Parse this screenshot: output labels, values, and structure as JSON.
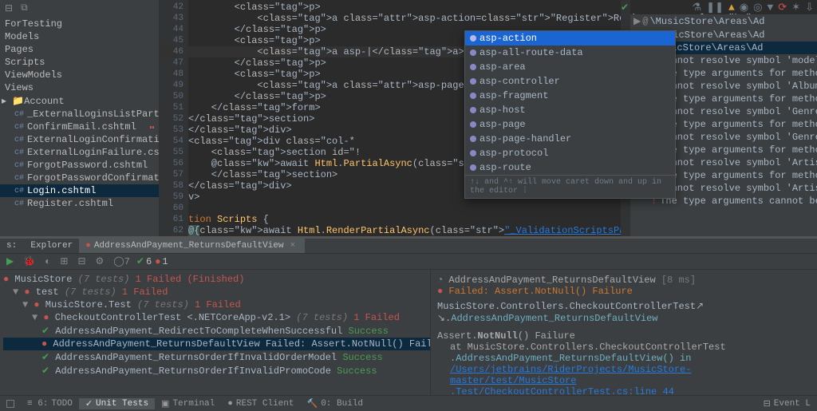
{
  "project_tree": {
    "folders": [
      "ForTesting",
      "Models",
      "Pages",
      "Scripts",
      "ViewModels",
      "Views"
    ],
    "active_folder": "Account",
    "files": [
      "_ExternalLoginsListPartial.c",
      "ConfirmEmail.cshtml",
      "ExternalLoginConfirmation.c",
      "ExternalLoginFailure.cshtm",
      "ForgotPassword.cshtml",
      "ForgotPasswordConfirmatic",
      "Login.cshtml",
      "Register.cshtml"
    ],
    "selected": "Login.cshtml"
  },
  "editor": {
    "line_start": 42,
    "lines": [
      "        <p>",
      "            <a asp-action=\"Register\">Register as a new user?</a>",
      "        </p>",
      "        <p>",
      "            <a asp-|</a>",
      "        </p>",
      "        <p>",
      "            <a asp-page=\"./ForgotPassword\">Forgot your password?</a>",
      "        </p>",
      "    </form>",
      "</section>",
      "</div>",
      "<div class=\"col-*",
      "    <section id=\"!",
      "    @await Html.PartialAsync(\"_ExternalLoginsListPartial\", new ExternalLogin!",
      "    </section>",
      "</div>",
      "v>",
      "",
      "tion Scripts {",
      "@{await Html.RenderPartialAsync(\"_ValidationScriptsPartial\"); }",
      ""
    ]
  },
  "completion": {
    "prefix": "asp-",
    "items": [
      "asp-action",
      "asp-all-route-data",
      "asp-area",
      "asp-controller",
      "asp-fragment",
      "asp-host",
      "asp-page",
      "asp-page-handler",
      "asp-protocol",
      "asp-route"
    ],
    "selected": 0,
    "hint": "↑↓ and ^↑ will move caret down and up in the editor  ⁞"
  },
  "errors": {
    "groups": [
      "<samples>\\MusicStore\\Areas\\Ad",
      "<samples>\\MusicStore\\Areas\\Ad",
      "<samples>\\MusicStore\\Areas\\Ad"
    ],
    "items": [
      "Cannot resolve symbol 'model'",
      "The type arguments for method",
      "Cannot resolve symbol 'AlbumId",
      "The type arguments for method",
      "Cannot resolve symbol 'GenreId",
      "The type arguments for method",
      "Cannot resolve symbol 'GenreId",
      "The type arguments for method",
      "Cannot resolve symbol 'ArtistId",
      "The type arguments for method",
      "Cannot resolve symbol 'ArtistId",
      "The type arguments cannot be i"
    ]
  },
  "tests_tabs": {
    "left": "Explorer",
    "right": "AddressAndPayment_ReturnsDefaultView"
  },
  "tests_counts": {
    "pass": 6,
    "fail": 1
  },
  "tests_tree": {
    "root": {
      "name": "MusicStore",
      "count": "(7 tests)",
      "status": "1 Failed (Finished)"
    },
    "level1": {
      "name": "test",
      "count": "(7 tests)",
      "status": "1 Failed"
    },
    "level2": {
      "name": "MusicStore.Test",
      "count": "(7 tests)",
      "status": "1 Failed"
    },
    "level3": {
      "name": "CheckoutControllerTest <.NETCoreApp-v2.1>",
      "count": "(7 tests)",
      "status": "1 Failed"
    },
    "leaves": [
      {
        "name": "AddressAndPayment_RedirectToCompleteWhenSuccessful",
        "status": "Success",
        "ok": true
      },
      {
        "name": "AddressAndPayment_ReturnsDefaultView  Failed: Assert.NotNull() Failure",
        "status": "",
        "ok": false,
        "sel": true
      },
      {
        "name": "AddressAndPayment_ReturnsOrderIfInvalidOrderModel",
        "status": "Success",
        "ok": true
      },
      {
        "name": "AddressAndPayment_ReturnsOrderIfInvalidPromoCode",
        "status": "Success",
        "ok": true
      }
    ]
  },
  "tests_out": {
    "title": "AddressAndPayment_ReturnsDefaultView",
    "time": "[8 ms]",
    "fail_line": "Failed: Assert.NotNull() Failure",
    "cls": "MusicStore.Controllers.CheckoutControllerTest",
    "mtd": "AddressAndPayment_ReturnsDefaultView",
    "assert": "Assert.NotNull()",
    "failure_word": "Failure",
    "at": "at MusicStore.Controllers.CheckoutControllerTest",
    "in_mtd": ".AddressAndPayment_ReturnsDefaultView() in",
    "path1": "/Users/jetbrains/RiderProjects/MusicStore-master/test/MusicStore",
    "path2": ".Test/CheckoutControllerTest.cs:line 44"
  },
  "status": {
    "items": [
      "TODO",
      "Unit Tests",
      "Terminal",
      "REST Client",
      "0: Build"
    ],
    "right": "Event L",
    "active": "Unit Tests"
  }
}
